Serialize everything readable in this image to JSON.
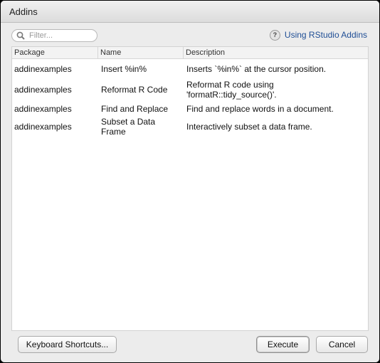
{
  "window": {
    "title": "Addins"
  },
  "filter": {
    "placeholder": "Filter..."
  },
  "help": {
    "icon": "question-mark",
    "link_label": "Using RStudio Addins"
  },
  "table": {
    "headers": {
      "package": "Package",
      "name": "Name",
      "description": "Description"
    },
    "rows": [
      {
        "package": "addinexamples",
        "name": "Insert %in%",
        "description": "Inserts `%in%` at the cursor position."
      },
      {
        "package": "addinexamples",
        "name": "Reformat R Code",
        "description_line1": "Reformat R code using",
        "description_line2": "'formatR::tidy_source()'."
      },
      {
        "package": "addinexamples",
        "name": "Find and Replace",
        "description": "Find and replace words in a document."
      },
      {
        "package": "addinexamples",
        "name_line1": "Subset a Data",
        "name_line2": "Frame",
        "description": "Interactively subset a data frame."
      }
    ]
  },
  "buttons": {
    "keyboard_shortcuts": "Keyboard Shortcuts...",
    "execute": "Execute",
    "cancel": "Cancel"
  },
  "colors": {
    "link": "#1f4e95",
    "dialog_bg": "#ececec",
    "table_bg": "#ffffff"
  }
}
